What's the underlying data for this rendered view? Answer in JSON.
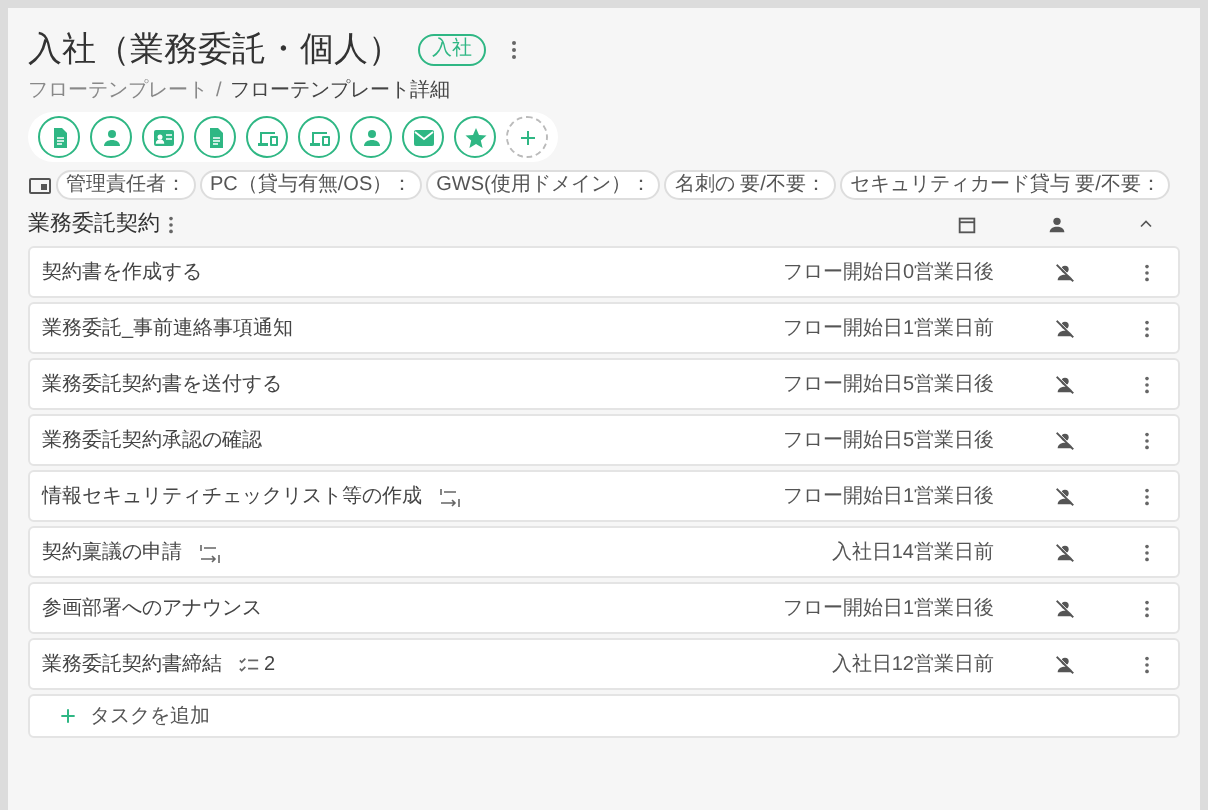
{
  "title": "入社（業務委託・個人）",
  "title_badge": "入社",
  "breadcrumb": [
    "フローテンプレート",
    "フローテンプレート詳細"
  ],
  "breadcrumb_separator": "/",
  "toolbar": [
    {
      "kind": "document"
    },
    {
      "kind": "person"
    },
    {
      "kind": "id-card"
    },
    {
      "kind": "document"
    },
    {
      "kind": "devices"
    },
    {
      "kind": "devices"
    },
    {
      "kind": "person"
    },
    {
      "kind": "mail"
    },
    {
      "kind": "star"
    },
    {
      "kind": "add"
    }
  ],
  "fields": [
    "管理責任者：",
    "PC（貸与有無/OS）：",
    "GWS(使用ドメイン）：",
    "名刺の 要/不要：",
    "セキュリティカード貸与 要/不要："
  ],
  "section": {
    "title": "業務委託契約",
    "expanded": true
  },
  "tasks": [
    {
      "kind": "plain",
      "title": "契約書を作成する",
      "timing": "フロー開始日0営業日後"
    },
    {
      "kind": "plain",
      "title": "業務委託_事前連絡事項通知",
      "timing": "フロー開始日1営業日前"
    },
    {
      "kind": "plain",
      "title": "業務委託契約書を送付する",
      "timing": "フロー開始日5営業日後"
    },
    {
      "kind": "plain",
      "title": "業務委託契約承認の確認",
      "timing": "フロー開始日5営業日後"
    },
    {
      "kind": "skip",
      "title": "情報セキュリティチェックリスト等の作成",
      "timing": "フロー開始日1営業日後"
    },
    {
      "kind": "skip",
      "title": "契約稟議の申請",
      "timing": "入社日14営業日前"
    },
    {
      "kind": "plain",
      "title": "参画部署へのアナウンス",
      "timing": "フロー開始日1営業日後"
    },
    {
      "kind": "checklist",
      "title": "業務委託契約書締結",
      "timing": "入社日12営業日前",
      "checklist_count": "2"
    }
  ],
  "add_task": "タスクを追加"
}
